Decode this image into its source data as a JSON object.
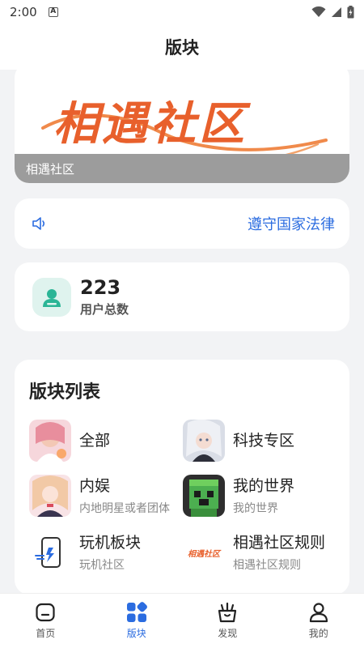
{
  "status_bar": {
    "time": "2:00",
    "a_indicator": "A"
  },
  "header": {
    "title": "版块"
  },
  "banner": {
    "logo_text": "相遇社区",
    "caption": "相遇社区"
  },
  "notice": {
    "icon": "speaker-icon",
    "text": "遵守国家法律"
  },
  "stats": {
    "icon": "user-icon",
    "value": "223",
    "label": "用户总数"
  },
  "board_list": {
    "title": "版块列表",
    "items": [
      {
        "name": "全部",
        "desc": ""
      },
      {
        "name": "科技专区",
        "desc": ""
      },
      {
        "name": "内娱",
        "desc": "内地明星或者团体"
      },
      {
        "name": "我的世界",
        "desc": "我的世界"
      },
      {
        "name": "玩机板块",
        "desc": "玩机社区"
      },
      {
        "name": "相遇社区规则",
        "desc": "相遇社区规则"
      }
    ],
    "rules_thumb_text": "相遇社区"
  },
  "tabbar": {
    "tabs": [
      {
        "label": "首页",
        "icon": "home-icon"
      },
      {
        "label": "版块",
        "icon": "boards-icon"
      },
      {
        "label": "发现",
        "icon": "discover-icon"
      },
      {
        "label": "我的",
        "icon": "profile-icon"
      }
    ],
    "active_index": 1
  },
  "colors": {
    "accent": "#2b6ce0",
    "brand_orange": "#e8602c",
    "stats_bg": "#dff3ee",
    "stats_icon": "#2bb596"
  }
}
